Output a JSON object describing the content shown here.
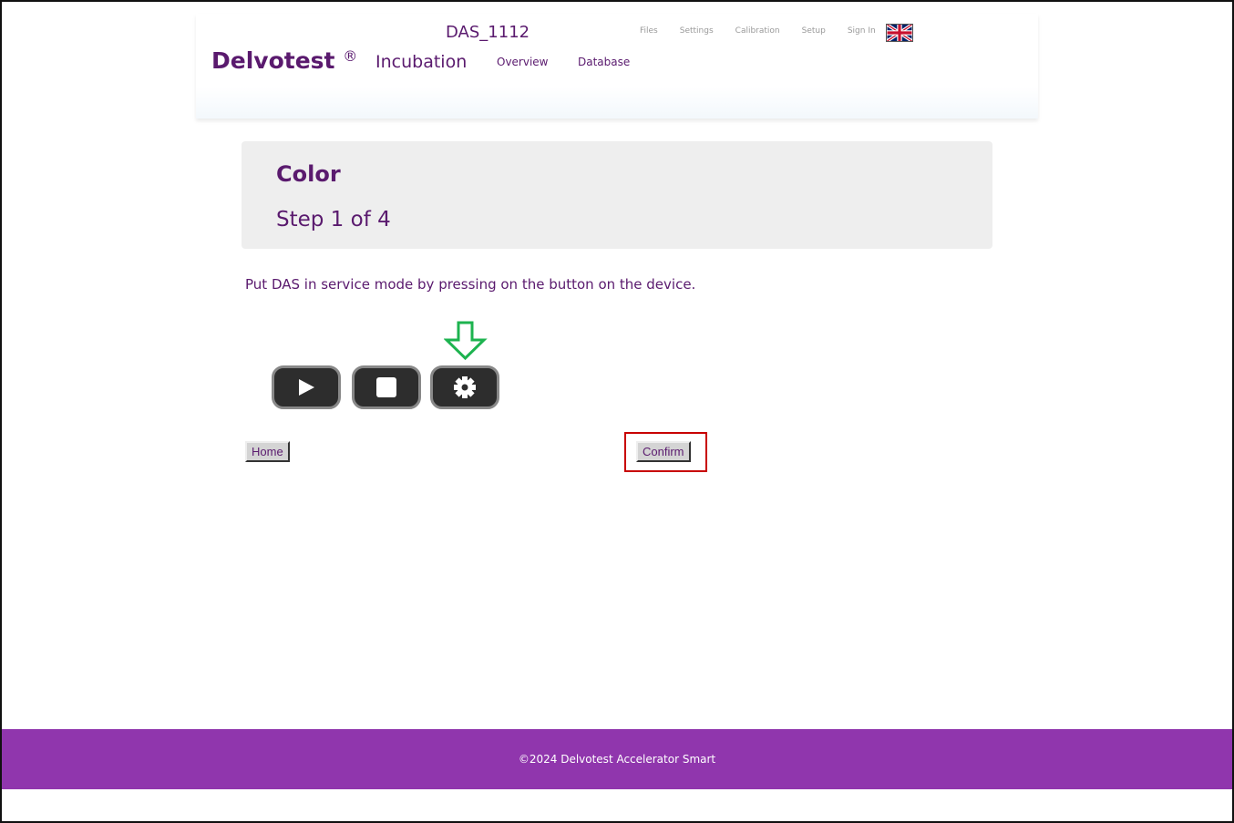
{
  "header": {
    "device_name": "DAS_1112",
    "top_links": [
      "Files",
      "Settings",
      "Calibration",
      "Setup",
      "Sign In"
    ],
    "flag": "uk-flag-icon",
    "brand": "Delvotest",
    "brand_mark": "®",
    "nav": [
      "Incubation",
      "Overview",
      "Database"
    ]
  },
  "panel": {
    "title": "Color",
    "step": "Step 1 of 4"
  },
  "instruction": "Put DAS in service mode by pressing on the button on the device.",
  "device_buttons": [
    "play-icon",
    "stop-icon",
    "gear-icon"
  ],
  "buttons": {
    "home": "Home",
    "confirm": "Confirm"
  },
  "footer": "©2024 Delvotest Accelerator Smart",
  "colors": {
    "brand": "#5a1a6e",
    "footer": "#9036ad",
    "arrow": "#1db34f",
    "highlight": "#c80000"
  }
}
